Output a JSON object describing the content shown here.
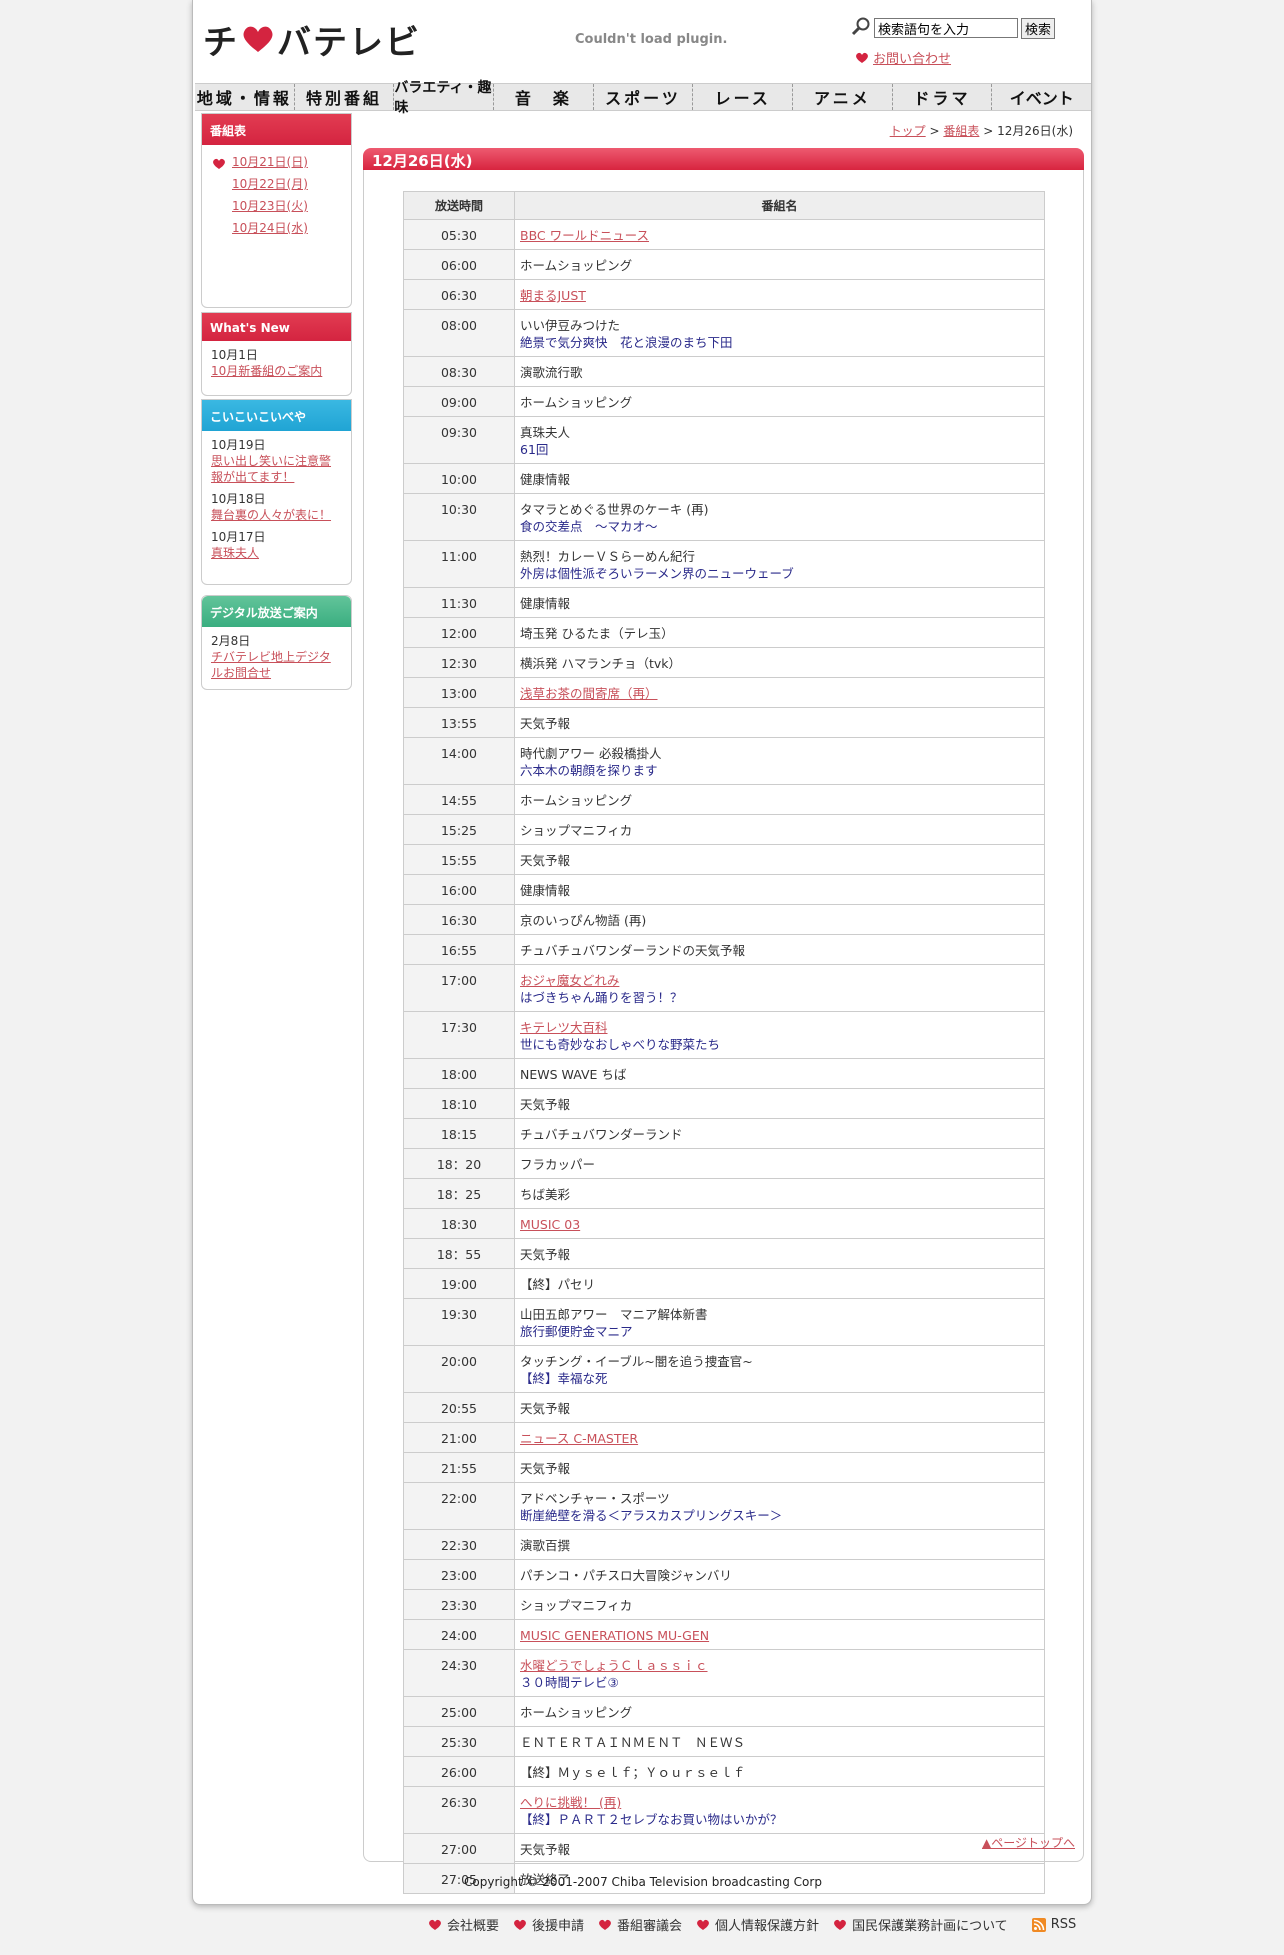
{
  "header": {
    "plugin_message": "Couldn't load plugin.",
    "search_placeholder": "検索語句を入力",
    "search_button": "検索",
    "contact": "お問い合わせ"
  },
  "nav": [
    "地域・情報",
    "特別番組",
    "バラエティ・趣味",
    "音　楽",
    "スポーツ",
    "レース",
    "アニメ",
    "ドラマ",
    "イベント"
  ],
  "sidebar": {
    "schedule": {
      "title": "番組表",
      "dates": [
        "10月21日(日)",
        "10月22日(月)",
        "10月23日(火)",
        "10月24日(水)"
      ]
    },
    "whatsnew": {
      "title": "What's New",
      "date": "10月1日",
      "link": "10月新番組のご案内"
    },
    "koi": {
      "title": "こいこいこいべや",
      "entries": [
        {
          "date": "10月19日",
          "link": "思い出し笑いに注意警報が出てます！"
        },
        {
          "date": "10月18日",
          "link": "舞台裏の人々が表に！"
        },
        {
          "date": "10月17日",
          "link": "真珠夫人"
        }
      ]
    },
    "digital": {
      "title": "デジタル放送ご案内",
      "date": "2月8日",
      "link": "チバテレビ地上デジタルお問合せ"
    }
  },
  "breadcrumb": {
    "top": "トップ",
    "sched": "番組表",
    "current": "12月26日(水)"
  },
  "main": {
    "title": "12月26日(水)",
    "col_time": "放送時間",
    "col_name": "番組名",
    "pagetop": "▲ページトップへ",
    "rows": [
      {
        "time": "05:30",
        "name": "BBC ワールドニュース",
        "link": true
      },
      {
        "time": "06:00",
        "name": "ホームショッピング"
      },
      {
        "time": "06:30",
        "name": "朝まるJUST",
        "link": true
      },
      {
        "time": "08:00",
        "name": "いい伊豆みつけた",
        "sub": "絶景で気分爽快　花と浪漫のまち下田"
      },
      {
        "time": "08:30",
        "name": "演歌流行歌"
      },
      {
        "time": "09:00",
        "name": "ホームショッピング"
      },
      {
        "time": "09:30",
        "name": "真珠夫人",
        "sub": "61回"
      },
      {
        "time": "10:00",
        "name": "健康情報"
      },
      {
        "time": "10:30",
        "name": "タマラとめぐる世界のケーキ (再)",
        "sub": "食の交差点　～マカオ～"
      },
      {
        "time": "11:00",
        "name": "熱烈！カレーＶＳらーめん紀行",
        "sub": "外房は個性派ぞろいラーメン界のニューウェーブ"
      },
      {
        "time": "11:30",
        "name": "健康情報"
      },
      {
        "time": "12:00",
        "name": "埼玉発 ひるたま（テレ玉）"
      },
      {
        "time": "12:30",
        "name": "横浜発 ハマランチョ（tvk）"
      },
      {
        "time": "13:00",
        "name": "浅草お茶の間寄席（再）",
        "link": true
      },
      {
        "time": "13:55",
        "name": "天気予報"
      },
      {
        "time": "14:00",
        "name": "時代劇アワー 必殺橋掛人",
        "sub": "六本木の朝顔を探ります"
      },
      {
        "time": "14:55",
        "name": "ホームショッピング"
      },
      {
        "time": "15:25",
        "name": "ショップマニフィカ"
      },
      {
        "time": "15:55",
        "name": "天気予報"
      },
      {
        "time": "16:00",
        "name": "健康情報"
      },
      {
        "time": "16:30",
        "name": "京のいっぴん物語 (再)"
      },
      {
        "time": "16:55",
        "name": "チュバチュバワンダーランドの天気予報"
      },
      {
        "time": "17:00",
        "name": "おジャ魔女どれみ",
        "link": true,
        "sub": "はづきちゃん踊りを習う！？"
      },
      {
        "time": "17:30",
        "name": "キテレツ大百科",
        "link": true,
        "sub": "世にも奇妙なおしゃべりな野菜たち"
      },
      {
        "time": "18:00",
        "name": "NEWS WAVE ちば"
      },
      {
        "time": "18:10",
        "name": "天気予報"
      },
      {
        "time": "18:15",
        "name": "チュバチュバワンダーランド"
      },
      {
        "time": "18：20",
        "name": "フラカッパー"
      },
      {
        "time": "18：25",
        "name": "ちば美彩"
      },
      {
        "time": "18:30",
        "name": "MUSIC 03",
        "link": true
      },
      {
        "time": "18：55",
        "name": "天気予報"
      },
      {
        "time": "19:00",
        "name": "【終】パセリ"
      },
      {
        "time": "19:30",
        "name": "山田五郎アワー　マニア解体新書",
        "sub": "旅行郵便貯金マニア"
      },
      {
        "time": "20:00",
        "name": "タッチング・イーブル~闇を追う捜査官~",
        "sub": "【終】幸福な死"
      },
      {
        "time": "20:55",
        "name": "天気予報"
      },
      {
        "time": "21:00",
        "name": "ニュース C-MASTER",
        "link": true
      },
      {
        "time": "21:55",
        "name": "天気予報"
      },
      {
        "time": "22:00",
        "name": "アドベンチャー・スポーツ",
        "sub": "断崖絶壁を滑る＜アラスカスプリングスキー＞"
      },
      {
        "time": "22:30",
        "name": "演歌百撰"
      },
      {
        "time": "23:00",
        "name": "パチンコ・パチスロ大冒険ジャンバリ"
      },
      {
        "time": "23:30",
        "name": "ショップマニフィカ"
      },
      {
        "time": "24:00",
        "name": "MUSIC GENERATIONS MU-GEN",
        "link": true
      },
      {
        "time": "24:30",
        "name": "水曜どうでしょうＣｌａｓｓｉｃ",
        "link": true,
        "sub": "３０時間テレビ③"
      },
      {
        "time": "25:00",
        "name": "ホームショッピング"
      },
      {
        "time": "25:30",
        "name": "ＥＮＴＥＲＴＡＩＮＭＥＮＴ　ＮＥＷＳ"
      },
      {
        "time": "26:00",
        "name": "【終】Ｍｙｓｅｌｆ；Ｙｏｕｒｓｅｌｆ"
      },
      {
        "time": "26:30",
        "name": "へりに挑戦！ (再)",
        "link": true,
        "sub": "【終】ＰＡＲＴ２セレブなお買い物はいかが？"
      },
      {
        "time": "27:00",
        "name": "天気予報"
      },
      {
        "time": "27:05",
        "name": "放送終了"
      }
    ]
  },
  "copyright": "Copyright © 2001-2007 Chiba Television broadcasting Corp",
  "footer": [
    "会社概要",
    "後援申請",
    "番組審議会",
    "個人情報保護方針",
    "国民保護業務計画について"
  ],
  "footer_rss": "RSS",
  "colors": {
    "accent": "#d42440",
    "link": "#c8505a",
    "sub": "#2a2a8a"
  }
}
